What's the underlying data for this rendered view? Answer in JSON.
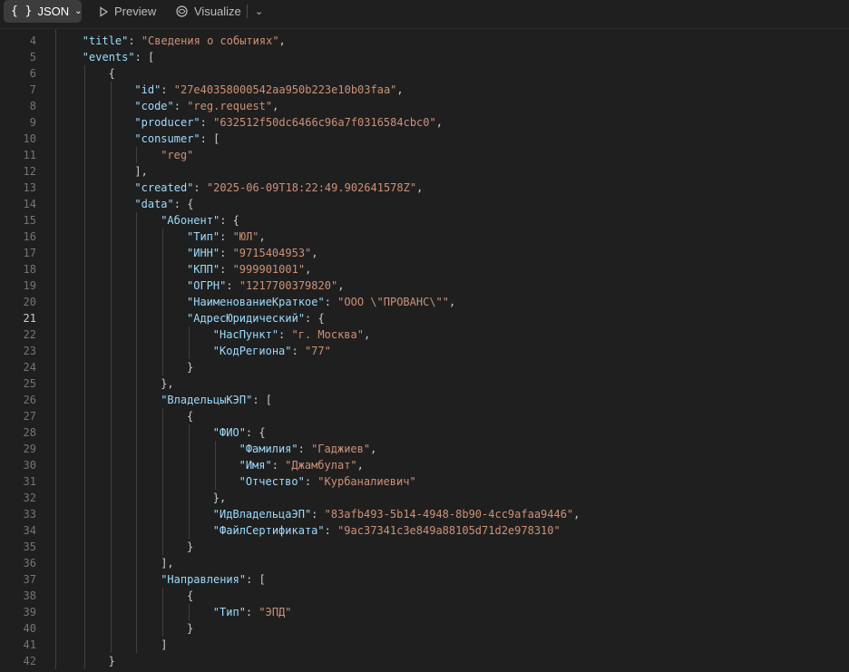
{
  "toolbar": {
    "json_label": "JSON",
    "json_icon": "{ }",
    "preview_label": "Preview",
    "visualize_label": "Visualize"
  },
  "editor": {
    "active_line": "21",
    "lines": [
      {
        "n": "4",
        "indent": 1,
        "parts": [
          {
            "t": "key",
            "v": "\"title\""
          },
          {
            "t": "pun",
            "v": ": "
          },
          {
            "t": "str",
            "v": "\"Сведения о событиях\""
          },
          {
            "t": "pun",
            "v": ","
          }
        ]
      },
      {
        "n": "5",
        "indent": 1,
        "parts": [
          {
            "t": "key",
            "v": "\"events\""
          },
          {
            "t": "pun",
            "v": ": ["
          }
        ]
      },
      {
        "n": "6",
        "indent": 2,
        "parts": [
          {
            "t": "pun",
            "v": "{"
          }
        ]
      },
      {
        "n": "7",
        "indent": 3,
        "parts": [
          {
            "t": "key",
            "v": "\"id\""
          },
          {
            "t": "pun",
            "v": ": "
          },
          {
            "t": "str",
            "v": "\"27e40358000542aa950b223e10b03faa\""
          },
          {
            "t": "pun",
            "v": ","
          }
        ]
      },
      {
        "n": "8",
        "indent": 3,
        "parts": [
          {
            "t": "key",
            "v": "\"code\""
          },
          {
            "t": "pun",
            "v": ": "
          },
          {
            "t": "str",
            "v": "\"reg.request\""
          },
          {
            "t": "pun",
            "v": ","
          }
        ]
      },
      {
        "n": "9",
        "indent": 3,
        "parts": [
          {
            "t": "key",
            "v": "\"producer\""
          },
          {
            "t": "pun",
            "v": ": "
          },
          {
            "t": "str",
            "v": "\"632512f50dc6466c96a7f0316584cbc0\""
          },
          {
            "t": "pun",
            "v": ","
          }
        ]
      },
      {
        "n": "10",
        "indent": 3,
        "parts": [
          {
            "t": "key",
            "v": "\"consumer\""
          },
          {
            "t": "pun",
            "v": ": ["
          }
        ]
      },
      {
        "n": "11",
        "indent": 4,
        "parts": [
          {
            "t": "str",
            "v": "\"reg\""
          }
        ]
      },
      {
        "n": "12",
        "indent": 3,
        "parts": [
          {
            "t": "pun",
            "v": "],"
          }
        ]
      },
      {
        "n": "13",
        "indent": 3,
        "parts": [
          {
            "t": "key",
            "v": "\"created\""
          },
          {
            "t": "pun",
            "v": ": "
          },
          {
            "t": "str",
            "v": "\"2025-06-09T18:22:49.902641578Z\""
          },
          {
            "t": "pun",
            "v": ","
          }
        ]
      },
      {
        "n": "14",
        "indent": 3,
        "parts": [
          {
            "t": "key",
            "v": "\"data\""
          },
          {
            "t": "pun",
            "v": ": {"
          }
        ]
      },
      {
        "n": "15",
        "indent": 4,
        "parts": [
          {
            "t": "key",
            "v": "\"Абонент\""
          },
          {
            "t": "pun",
            "v": ": {"
          }
        ]
      },
      {
        "n": "16",
        "indent": 5,
        "parts": [
          {
            "t": "key",
            "v": "\"Тип\""
          },
          {
            "t": "pun",
            "v": ": "
          },
          {
            "t": "str",
            "v": "\"ЮЛ\""
          },
          {
            "t": "pun",
            "v": ","
          }
        ]
      },
      {
        "n": "17",
        "indent": 5,
        "parts": [
          {
            "t": "key",
            "v": "\"ИНН\""
          },
          {
            "t": "pun",
            "v": ": "
          },
          {
            "t": "str",
            "v": "\"9715404953\""
          },
          {
            "t": "pun",
            "v": ","
          }
        ]
      },
      {
        "n": "18",
        "indent": 5,
        "parts": [
          {
            "t": "key",
            "v": "\"КПП\""
          },
          {
            "t": "pun",
            "v": ": "
          },
          {
            "t": "str",
            "v": "\"999901001\""
          },
          {
            "t": "pun",
            "v": ","
          }
        ]
      },
      {
        "n": "19",
        "indent": 5,
        "parts": [
          {
            "t": "key",
            "v": "\"ОГРН\""
          },
          {
            "t": "pun",
            "v": ": "
          },
          {
            "t": "str",
            "v": "\"1217700379820\""
          },
          {
            "t": "pun",
            "v": ","
          }
        ]
      },
      {
        "n": "20",
        "indent": 5,
        "parts": [
          {
            "t": "key",
            "v": "\"НаименованиеКраткое\""
          },
          {
            "t": "pun",
            "v": ": "
          },
          {
            "t": "str",
            "v": "\"ООО \\\"ПРОВАНС\\\"\""
          },
          {
            "t": "pun",
            "v": ","
          }
        ]
      },
      {
        "n": "21",
        "indent": 5,
        "parts": [
          {
            "t": "key",
            "v": "\"АдресЮридический\""
          },
          {
            "t": "pun",
            "v": ": {"
          }
        ]
      },
      {
        "n": "22",
        "indent": 6,
        "parts": [
          {
            "t": "key",
            "v": "\"НасПункт\""
          },
          {
            "t": "pun",
            "v": ": "
          },
          {
            "t": "str",
            "v": "\"г. Москва\""
          },
          {
            "t": "pun",
            "v": ","
          }
        ]
      },
      {
        "n": "23",
        "indent": 6,
        "parts": [
          {
            "t": "key",
            "v": "\"КодРегиона\""
          },
          {
            "t": "pun",
            "v": ": "
          },
          {
            "t": "str",
            "v": "\"77\""
          }
        ]
      },
      {
        "n": "24",
        "indent": 5,
        "parts": [
          {
            "t": "pun",
            "v": "}"
          }
        ]
      },
      {
        "n": "25",
        "indent": 4,
        "parts": [
          {
            "t": "pun",
            "v": "},"
          }
        ]
      },
      {
        "n": "26",
        "indent": 4,
        "parts": [
          {
            "t": "key",
            "v": "\"ВладельцыКЭП\""
          },
          {
            "t": "pun",
            "v": ": ["
          }
        ]
      },
      {
        "n": "27",
        "indent": 5,
        "parts": [
          {
            "t": "pun",
            "v": "{"
          }
        ]
      },
      {
        "n": "28",
        "indent": 6,
        "parts": [
          {
            "t": "key",
            "v": "\"ФИО\""
          },
          {
            "t": "pun",
            "v": ": {"
          }
        ]
      },
      {
        "n": "29",
        "indent": 7,
        "parts": [
          {
            "t": "key",
            "v": "\"Фамилия\""
          },
          {
            "t": "pun",
            "v": ": "
          },
          {
            "t": "str",
            "v": "\"Гаджиев\""
          },
          {
            "t": "pun",
            "v": ","
          }
        ]
      },
      {
        "n": "30",
        "indent": 7,
        "parts": [
          {
            "t": "key",
            "v": "\"Имя\""
          },
          {
            "t": "pun",
            "v": ": "
          },
          {
            "t": "str",
            "v": "\"Джамбулат\""
          },
          {
            "t": "pun",
            "v": ","
          }
        ]
      },
      {
        "n": "31",
        "indent": 7,
        "parts": [
          {
            "t": "key",
            "v": "\"Отчество\""
          },
          {
            "t": "pun",
            "v": ": "
          },
          {
            "t": "str",
            "v": "\"Курбаналиевич\""
          }
        ]
      },
      {
        "n": "32",
        "indent": 6,
        "parts": [
          {
            "t": "pun",
            "v": "},"
          }
        ]
      },
      {
        "n": "33",
        "indent": 6,
        "parts": [
          {
            "t": "key",
            "v": "\"ИдВладельцаЭП\""
          },
          {
            "t": "pun",
            "v": ": "
          },
          {
            "t": "str",
            "v": "\"83afb493-5b14-4948-8b90-4cc9afaa9446\""
          },
          {
            "t": "pun",
            "v": ","
          }
        ]
      },
      {
        "n": "34",
        "indent": 6,
        "parts": [
          {
            "t": "key",
            "v": "\"ФайлСертификата\""
          },
          {
            "t": "pun",
            "v": ": "
          },
          {
            "t": "str",
            "v": "\"9ac37341c3e849a88105d71d2e978310\""
          }
        ]
      },
      {
        "n": "35",
        "indent": 5,
        "parts": [
          {
            "t": "pun",
            "v": "}"
          }
        ]
      },
      {
        "n": "36",
        "indent": 4,
        "parts": [
          {
            "t": "pun",
            "v": "],"
          }
        ]
      },
      {
        "n": "37",
        "indent": 4,
        "parts": [
          {
            "t": "key",
            "v": "\"Направления\""
          },
          {
            "t": "pun",
            "v": ": ["
          }
        ]
      },
      {
        "n": "38",
        "indent": 5,
        "parts": [
          {
            "t": "pun",
            "v": "{"
          }
        ]
      },
      {
        "n": "39",
        "indent": 6,
        "parts": [
          {
            "t": "key",
            "v": "\"Тип\""
          },
          {
            "t": "pun",
            "v": ": "
          },
          {
            "t": "str",
            "v": "\"ЭПД\""
          }
        ]
      },
      {
        "n": "40",
        "indent": 5,
        "parts": [
          {
            "t": "pun",
            "v": "}"
          }
        ]
      },
      {
        "n": "41",
        "indent": 4,
        "parts": [
          {
            "t": "pun",
            "v": "]"
          }
        ]
      },
      {
        "n": "42",
        "indent": 2,
        "parts": [
          {
            "t": "pun",
            "v": "}"
          }
        ]
      }
    ]
  },
  "colors": {
    "background": "#1f1f1f",
    "key": "#9cdcfe",
    "string": "#ce9178",
    "line_number": "#6e7681"
  }
}
